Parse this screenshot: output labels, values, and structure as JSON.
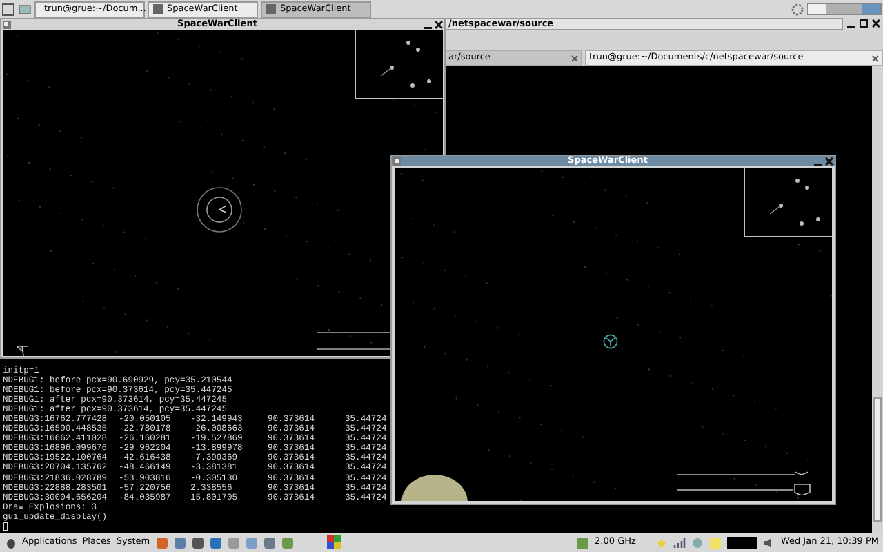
{
  "top_panel": {
    "tasks": [
      {
        "label": "trun@grue:~/Docum...",
        "selected": false
      },
      {
        "label": "SpaceWarClient",
        "selected": false
      },
      {
        "label": "SpaceWarClient",
        "selected": true
      }
    ]
  },
  "terminal": {
    "title": "/netspacewar/source",
    "tabs": [
      {
        "label": "ar/source",
        "selected": false
      },
      {
        "label": "trun@grue:~/Documents/c/netspacewar/source",
        "selected": true
      }
    ],
    "lines": [
      {
        "kind": "text",
        "text": "initp=1"
      },
      {
        "kind": "text",
        "text": "NDEBUG1: before pcx=90.690929, pcy=35.210544"
      },
      {
        "kind": "text",
        "text": "NDEBUG1: before pcx=90.373614, pcy=35.447245"
      },
      {
        "kind": "text",
        "text": "NDEBUG1: after pcx=90.373614, pcy=35.447245"
      },
      {
        "kind": "text",
        "text": "NDEBUG1: after pcx=90.373614, pcy=35.447245"
      },
      {
        "kind": "row",
        "cells": [
          "NDEBUG3:16762.777428",
          "-20.050105",
          "-32.149943",
          "90.373614",
          "35.44724"
        ]
      },
      {
        "kind": "row",
        "cells": [
          "NDEBUG3:16590.448535",
          "-22.780178",
          "-26.008663",
          "90.373614",
          "35.44724"
        ]
      },
      {
        "kind": "row",
        "cells": [
          "NDEBUG3:16662.411028",
          "-26.160281",
          "-19.527869",
          "90.373614",
          "35.44724"
        ]
      },
      {
        "kind": "row",
        "cells": [
          "NDEBUG3:16896.099676",
          "-29.962204",
          "-13.899978",
          "90.373614",
          "35.44724"
        ]
      },
      {
        "kind": "row",
        "cells": [
          "NDEBUG3:19522.100764",
          "-42.616438",
          "-7.390369",
          "90.373614",
          "35.44724"
        ]
      },
      {
        "kind": "row",
        "cells": [
          "NDEBUG3:20704.135762",
          "-48.466149",
          "-3.381381",
          "90.373614",
          "35.44724"
        ]
      },
      {
        "kind": "row",
        "cells": [
          "NDEBUG3:21836.028789",
          "-53.903816",
          "-0.305130",
          "90.373614",
          "35.44724"
        ]
      },
      {
        "kind": "row",
        "cells": [
          "NDEBUG3:22888.283501",
          "-57.220756",
          "2.338556",
          "90.373614",
          "35.44724"
        ]
      },
      {
        "kind": "row",
        "cells": [
          "NDEBUG3:30004.656204",
          "-84.035987",
          "15.801705",
          "90.373614",
          "35.44724"
        ]
      },
      {
        "kind": "text",
        "text": "Draw Explosions: 3"
      },
      {
        "kind": "text",
        "text": "gui_update_display()"
      }
    ]
  },
  "game_windows": [
    {
      "title": "SpaceWarClient",
      "active": false
    },
    {
      "title": "SpaceWarClient",
      "active": true
    }
  ],
  "bottom_panel": {
    "menus": [
      "Applications",
      "Places",
      "System"
    ],
    "cpu_freq": "2.00 GHz",
    "clock": "Wed Jan 21, 10:39 PM"
  }
}
